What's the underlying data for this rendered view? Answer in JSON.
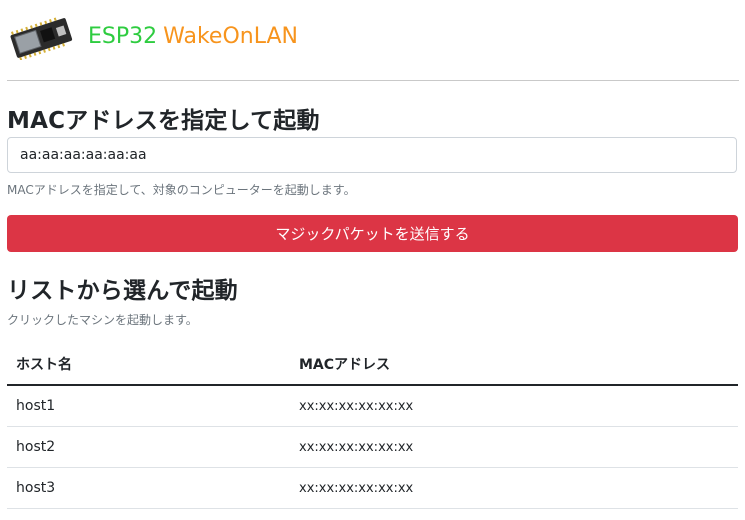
{
  "header": {
    "title_part1": "ESP32",
    "title_part2": "WakeOnLAN",
    "logo_icon": "esp32-board-icon",
    "colors": {
      "esp": "#2ecc40",
      "wol": "#f7941d"
    }
  },
  "mac_section": {
    "title": "MACアドレスを指定して起動",
    "input_value": "aa:aa:aa:aa:aa:aa",
    "help_text": "MACアドレスを指定して、対象のコンピューターを起動します。",
    "send_button_label": "マジックパケットを送信する",
    "button_color": "#dc3545"
  },
  "list_section": {
    "title": "リストから選んで起動",
    "help_text": "クリックしたマシンを起動します。",
    "columns": [
      "ホスト名",
      "MACアドレス"
    ],
    "rows": [
      {
        "host": "host1",
        "mac": "xx:xx:xx:xx:xx:xx"
      },
      {
        "host": "host2",
        "mac": "xx:xx:xx:xx:xx:xx"
      },
      {
        "host": "host3",
        "mac": "xx:xx:xx:xx:xx:xx"
      }
    ]
  }
}
